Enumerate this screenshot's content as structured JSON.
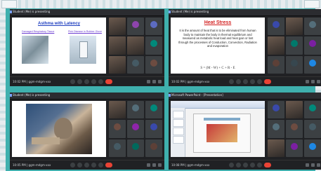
{
  "panels": [
    {
      "presenter": "Student (Me) is presenting",
      "time": "10:02 PM | ggm-mdgm-xxx",
      "slide": {
        "title": "Asthma with Latency",
        "captions": [
          "Damaged Respiratory Tissue",
          "Pink Disease in Rubber Glove"
        ]
      },
      "tiles": [
        "",
        "",
        "",
        "",
        "",
        "",
        "",
        "",
        ""
      ]
    },
    {
      "presenter": "Student (Me) is presenting",
      "time": "10:02 PM | ggm-mdgm-xxx",
      "slide": {
        "title": "Heat Stress",
        "body": "It is the amount of heat that is to be eliminated from human body to maintain the body in thermal equilibrium and measured as metabolic heat load and heat gain or lost through the processes of Conduction, Convection, Radiation and evaporation",
        "equation": "S = (M - W) + C + R - E"
      },
      "tiles": [
        "",
        "",
        "",
        "",
        "",
        "",
        "",
        "",
        ""
      ]
    },
    {
      "presenter": "Student (Me) is presenting",
      "time": "10:05 PM | ggm-mdgm-xxx",
      "slide": {},
      "tiles": [
        "",
        "",
        "",
        "",
        "",
        "",
        "",
        "",
        ""
      ]
    },
    {
      "presenter": "Microsoft PowerPoint - [Presentation]",
      "time": "10:08 PM | ggm-mdgm-xxx",
      "slide": {},
      "tiles": [
        "",
        "",
        "",
        "",
        "",
        "",
        "",
        "",
        ""
      ]
    }
  ],
  "colors": {
    "background": "#3fb0ae",
    "end_call": "#ea4335",
    "meet_dark": "#202124"
  }
}
